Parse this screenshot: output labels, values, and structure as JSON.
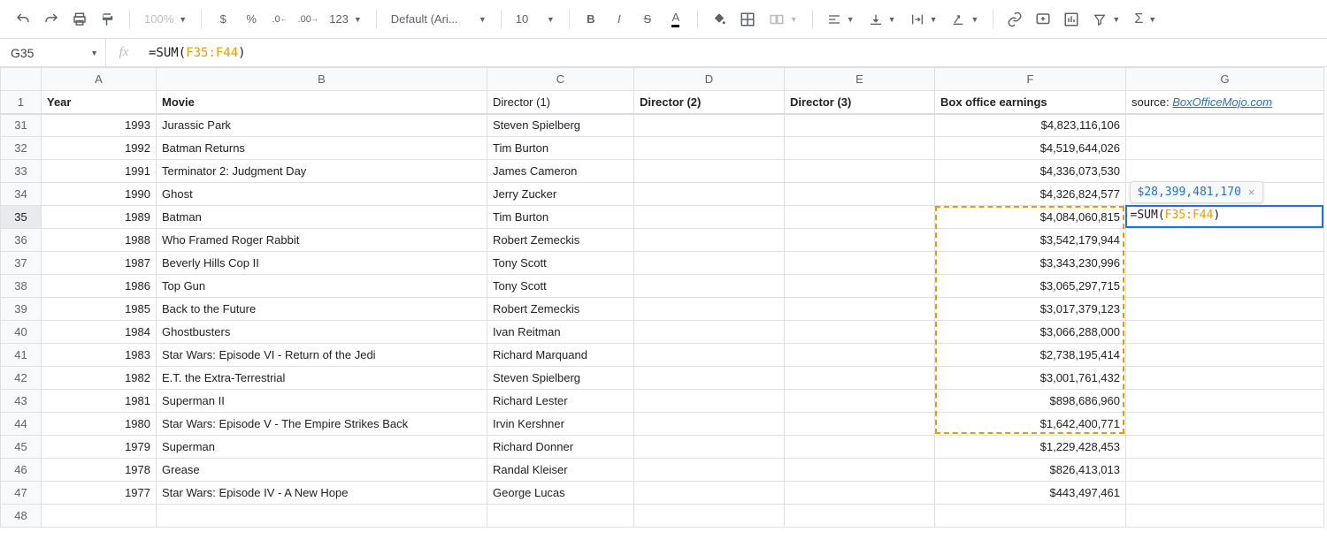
{
  "toolbar": {
    "zoom": "100%",
    "currency_icon": "$",
    "percent_icon": "%",
    "dec_dec": ".0",
    "inc_dec": ".00",
    "more_formats": "123",
    "font_name": "Default (Ari...",
    "font_size": "10"
  },
  "name_box": {
    "value": "G35"
  },
  "fx_label": "fx",
  "formula": {
    "prefix": "=SUM",
    "open": "(",
    "range": "F35:F44",
    "close": ")"
  },
  "columns": [
    "A",
    "B",
    "C",
    "D",
    "E",
    "F",
    "G"
  ],
  "header_row": {
    "num": "1",
    "A": "Year",
    "B": "Movie",
    "C": "Director (1)",
    "D": "Director (2)",
    "E": "Director (3)",
    "F": "Box office earnings",
    "G_prefix": "source: ",
    "G_link": "BoxOfficeMojo.com"
  },
  "rows": [
    {
      "n": "31",
      "year": "1993",
      "movie": "Jurassic Park",
      "dir": "Steven Spielberg",
      "box": "$4,823,116,106"
    },
    {
      "n": "32",
      "year": "1992",
      "movie": "Batman Returns",
      "dir": "Tim Burton",
      "box": "$4,519,644,026"
    },
    {
      "n": "33",
      "year": "1991",
      "movie": "Terminator 2: Judgment Day",
      "dir": "James Cameron",
      "box": "$4,336,073,530"
    },
    {
      "n": "34",
      "year": "1990",
      "movie": "Ghost",
      "dir": "Jerry Zucker",
      "box": "$4,326,824,577"
    },
    {
      "n": "35",
      "year": "1989",
      "movie": "Batman",
      "dir": "Tim Burton",
      "box": "$4,084,060,815"
    },
    {
      "n": "36",
      "year": "1988",
      "movie": "Who Framed Roger Rabbit",
      "dir": "Robert Zemeckis",
      "box": "$3,542,179,944"
    },
    {
      "n": "37",
      "year": "1987",
      "movie": "Beverly Hills Cop II",
      "dir": "Tony Scott",
      "box": "$3,343,230,996"
    },
    {
      "n": "38",
      "year": "1986",
      "movie": "Top Gun",
      "dir": "Tony Scott",
      "box": "$3,065,297,715"
    },
    {
      "n": "39",
      "year": "1985",
      "movie": "Back to the Future",
      "dir": "Robert Zemeckis",
      "box": "$3,017,379,123"
    },
    {
      "n": "40",
      "year": "1984",
      "movie": "Ghostbusters",
      "dir": "Ivan Reitman",
      "box": "$3,066,288,000"
    },
    {
      "n": "41",
      "year": "1983",
      "movie": "Star Wars: Episode VI - Return of the Jedi",
      "dir": "Richard Marquand",
      "box": "$2,738,195,414"
    },
    {
      "n": "42",
      "year": "1982",
      "movie": "E.T. the Extra-Terrestrial",
      "dir": "Steven Spielberg",
      "box": "$3,001,761,432"
    },
    {
      "n": "43",
      "year": "1981",
      "movie": "Superman II",
      "dir": "Richard Lester",
      "box": "$898,686,960"
    },
    {
      "n": "44",
      "year": "1980",
      "movie": "Star Wars: Episode V - The Empire Strikes Back",
      "dir": "Irvin Kershner",
      "box": "$1,642,400,771"
    },
    {
      "n": "45",
      "year": "1979",
      "movie": "Superman",
      "dir": "Richard Donner",
      "box": "$1,229,428,453"
    },
    {
      "n": "46",
      "year": "1978",
      "movie": "Grease",
      "dir": "Randal Kleiser",
      "box": "$826,413,013"
    },
    {
      "n": "47",
      "year": "1977",
      "movie": "Star Wars: Episode IV - A New Hope",
      "dir": "George Lucas",
      "box": "$443,497,461"
    }
  ],
  "empty_row": "48",
  "tooltip": {
    "value": "$28,399,481,170",
    "close": "×"
  },
  "active_cell_text": {
    "prefix": "=SUM",
    "open": "(",
    "range": "F35:F44",
    "close": ")"
  }
}
